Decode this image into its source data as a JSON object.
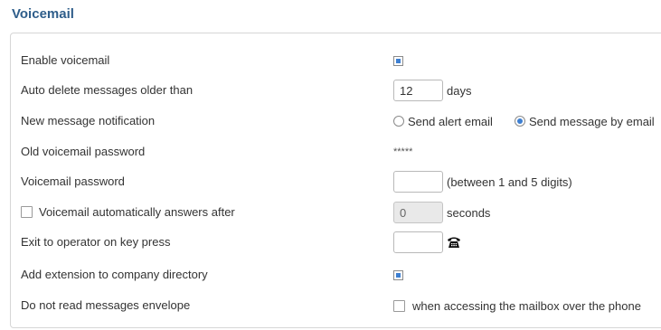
{
  "section": {
    "title": "Voicemail"
  },
  "rows": {
    "enable_voicemail": {
      "label": "Enable voicemail",
      "checked": true
    },
    "auto_delete": {
      "label": "Auto delete messages older than",
      "value": "12",
      "suffix": "days"
    },
    "notification": {
      "label": "New message notification",
      "options": [
        {
          "label": "Send alert email",
          "selected": false
        },
        {
          "label": "Send message by email",
          "selected": true
        }
      ]
    },
    "old_password": {
      "label": "Old voicemail password",
      "value": "*****"
    },
    "password": {
      "label": "Voicemail password",
      "value": "",
      "hint": "(between 1 and 5 digits)"
    },
    "auto_answer": {
      "label": "Voicemail automatically answers after",
      "checked": false,
      "value": "0",
      "suffix": "seconds",
      "disabled": true
    },
    "exit_operator": {
      "label": "Exit to operator on key press",
      "value": "",
      "icon": "telephone-icon"
    },
    "company_directory": {
      "label": "Add extension to company directory",
      "checked": true
    },
    "no_envelope": {
      "label": "Do not read messages envelope",
      "checked": false,
      "hint": "when accessing the mailbox over the phone"
    }
  },
  "colors": {
    "title": "#2e5d8a",
    "accent": "#3d7fd1",
    "border": "#d6d6d6"
  }
}
